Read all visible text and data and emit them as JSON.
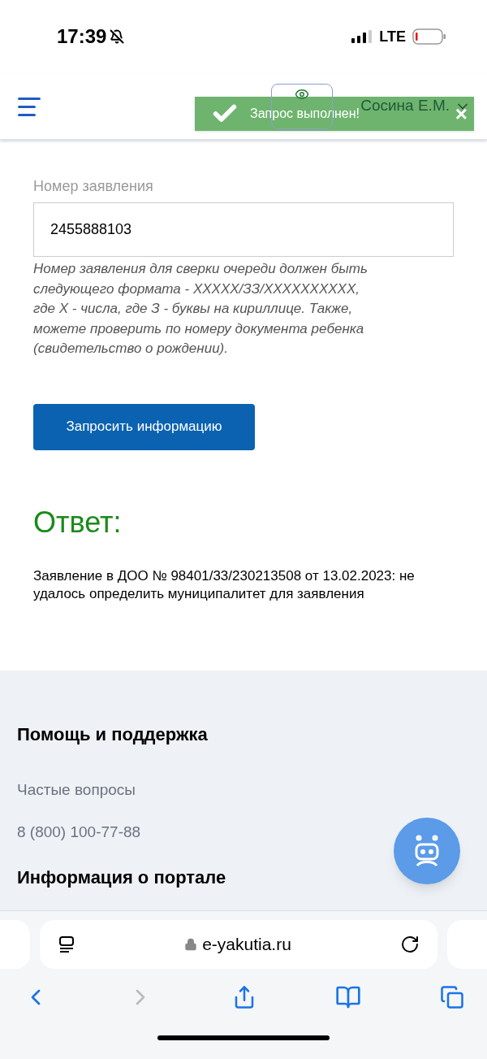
{
  "status_bar": {
    "time": "17:39",
    "network": "LTE"
  },
  "header": {
    "user_name": "Сосина Е.М."
  },
  "toast": {
    "message": "Запрос выполнен!",
    "close": "×"
  },
  "form": {
    "label": "Номер заявления",
    "value": "2455888103",
    "hint": "Номер заявления для сверки очереди должен быть следующего формата - XXXXX/ЗЗ/XXXXXXXXXX, где X - числа, где З - буквы на кириллице. Также, можете проверить по номеру документа ребенка (свидетельство о рождении).",
    "button": "Запросить информацию"
  },
  "answer": {
    "title": "Ответ:",
    "text": "Заявление в ДОО № 98401/33/230213508 от 13.02.2023: не удалось определить муниципалитет для заявления"
  },
  "footer": {
    "sections": [
      {
        "title": "Помощь и поддержка",
        "links": [
          "Частые вопросы",
          "8 (800) 100-77-88"
        ]
      },
      {
        "title": "Информация о портале"
      }
    ]
  },
  "browser": {
    "url": "e-yakutia.ru"
  }
}
